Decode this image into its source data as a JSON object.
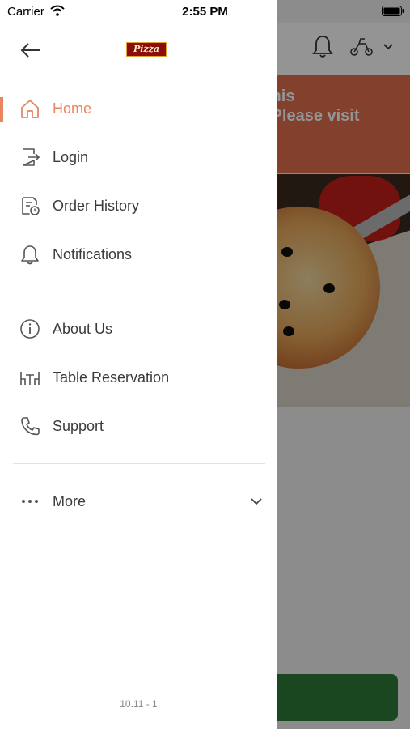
{
  "status_bar": {
    "carrier": "Carrier",
    "time": "2:55 PM"
  },
  "background": {
    "banner_lines": [
      "d, This",
      "on. Please visit",
      "/"
    ],
    "icons": [
      "bell-icon",
      "scooter-icon",
      "chevron-down-icon"
    ],
    "colors": {
      "banner": "#e06e4e",
      "button": "#2f7a37"
    }
  },
  "drawer": {
    "logo_text": "Pizza",
    "menu": [
      {
        "label": "Home",
        "icon": "home-icon",
        "active": true
      },
      {
        "label": "Login",
        "icon": "login-icon"
      },
      {
        "label": "Order History",
        "icon": "order-history-icon"
      },
      {
        "label": "Notifications",
        "icon": "bell-icon"
      }
    ],
    "menu2": [
      {
        "label": "About Us",
        "icon": "info-icon"
      },
      {
        "label": "Table Reservation",
        "icon": "table-icon"
      },
      {
        "label": "Support",
        "icon": "phone-icon"
      }
    ],
    "more": {
      "label": "More",
      "icon": "more-dots-icon"
    },
    "version": "10.11 - 1",
    "accent_color": "#e8855f"
  }
}
